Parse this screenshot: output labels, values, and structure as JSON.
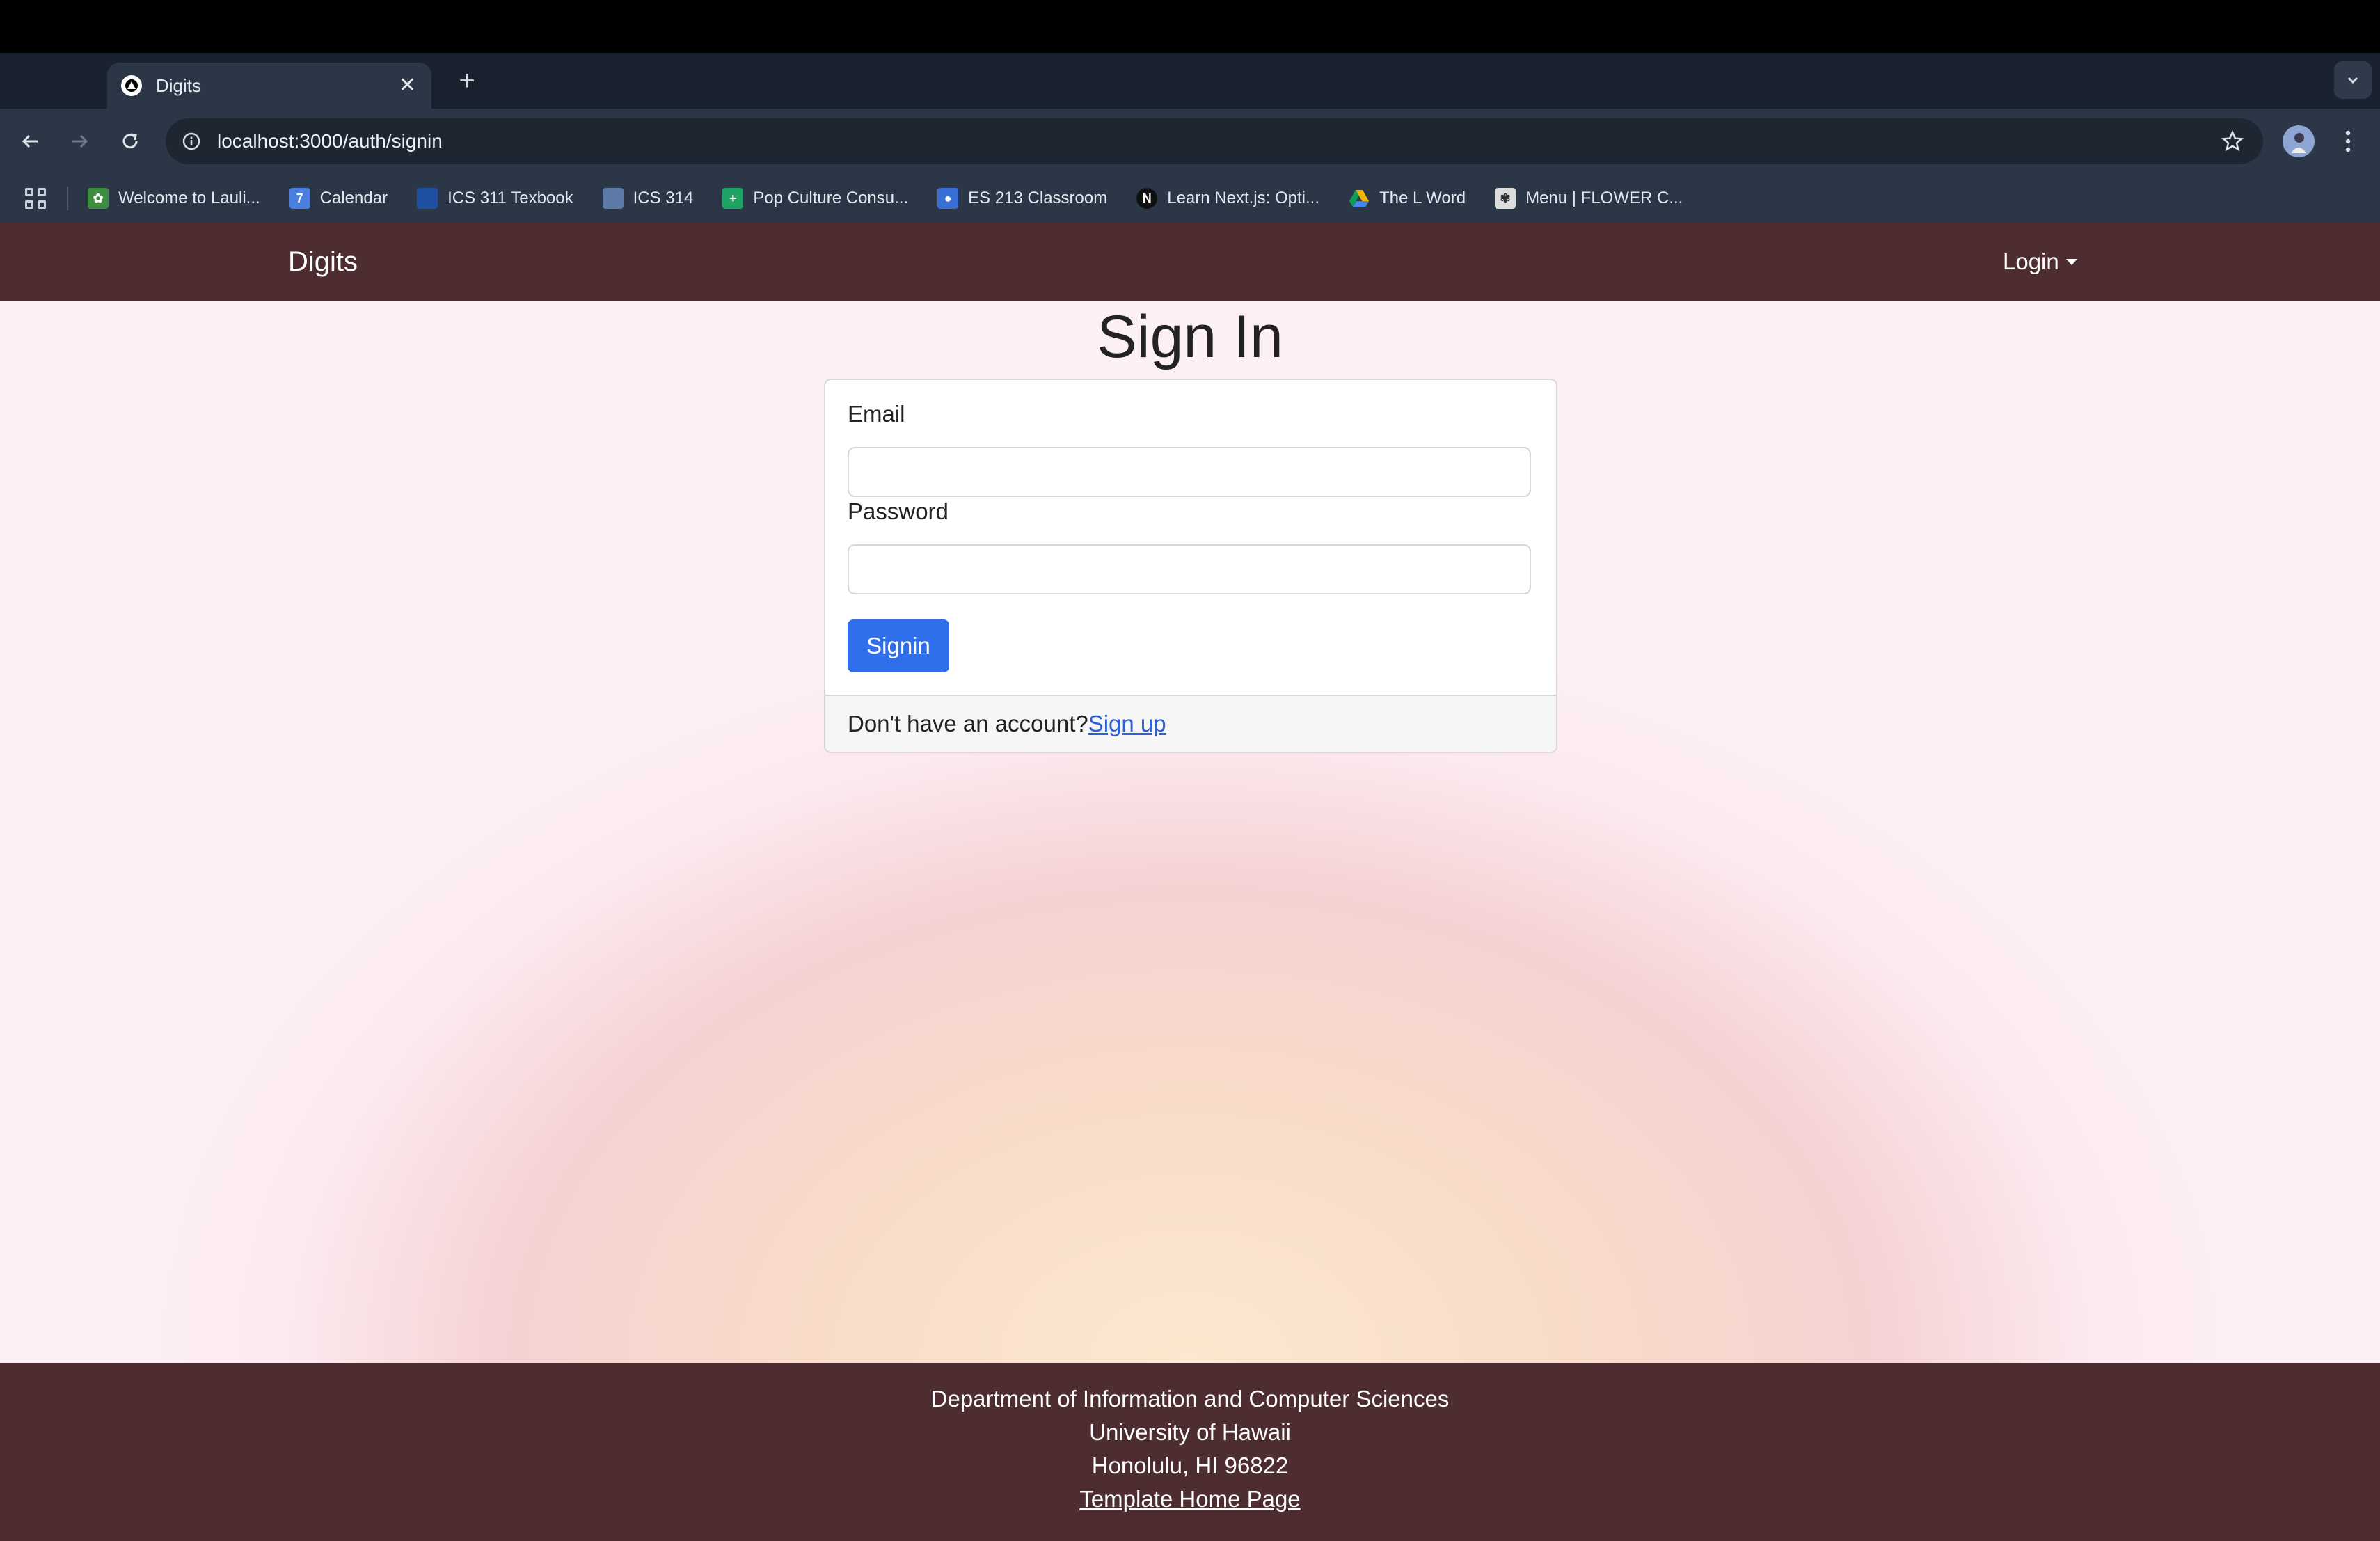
{
  "browser": {
    "tab_title": "Digits",
    "url": "localhost:3000/auth/signin",
    "bookmarks": [
      {
        "label": "Welcome to Lauli...",
        "icon": "leaf-icon",
        "color": "#3b8f3e"
      },
      {
        "label": "Calendar",
        "icon": "calendar-icon",
        "color": "#4a7fe0"
      },
      {
        "label": "ICS 311 Texbook",
        "icon": "book-icon",
        "color": "#1f4fa0"
      },
      {
        "label": "ICS 314",
        "icon": "square-icon",
        "color": "#5d7aa8"
      },
      {
        "label": "Pop Culture Consu...",
        "icon": "sheets-icon",
        "color": "#1fa463"
      },
      {
        "label": "ES 213 Classroom",
        "icon": "classroom-icon",
        "color": "#3a6fd8"
      },
      {
        "label": "Learn Next.js: Opti...",
        "icon": "nextjs-icon",
        "color": "#111111"
      },
      {
        "label": "The L Word",
        "icon": "drive-icon",
        "color": "#f4b400"
      },
      {
        "label": "Menu | FLOWER C...",
        "icon": "flower-icon",
        "color": "#dddddd"
      }
    ]
  },
  "navbar": {
    "brand": "Digits",
    "login": "Login"
  },
  "page": {
    "title": "Sign In",
    "email_label": "Email",
    "email_value": "",
    "password_label": "Password",
    "password_value": "",
    "submit_label": "Signin",
    "footer_prompt": "Don't have an account?",
    "signup_link": "Sign up"
  },
  "footer": {
    "line1": "Department of Information and Computer Sciences",
    "line2": "University of Hawaii",
    "line3": "Honolulu, HI 96822",
    "link": "Template Home Page"
  },
  "colors": {
    "navbar": "#4d2d30",
    "button": "#2f6fec",
    "link": "#2a62d6"
  }
}
